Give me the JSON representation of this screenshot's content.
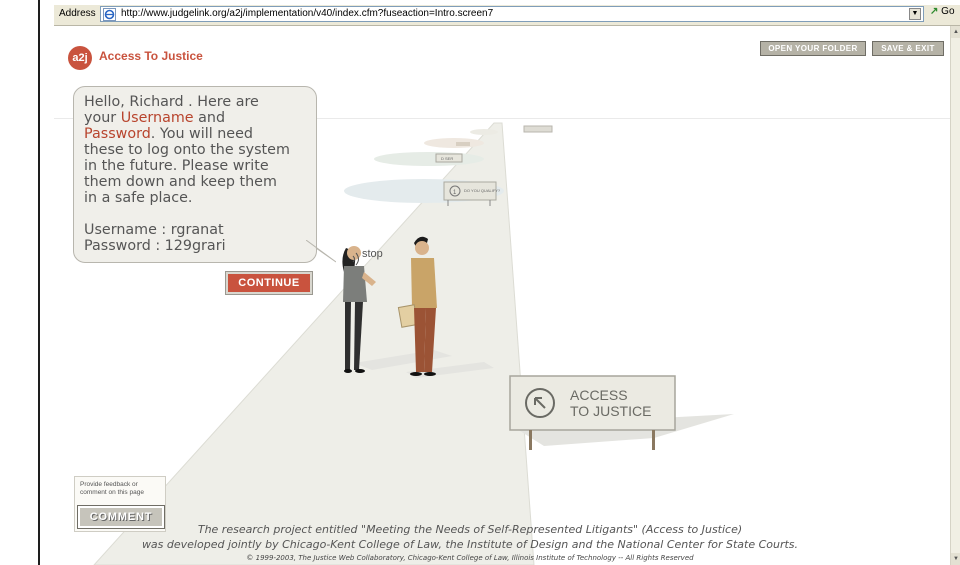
{
  "browser": {
    "address_label": "Address",
    "url": "http://www.judgelink.org/a2j/implementation/v40/index.cfm?fuseaction=Intro.screen7",
    "go_label": "Go"
  },
  "header": {
    "logo_text": "a2j",
    "app_title": "Access To Justice",
    "open_folder_label": "OPEN YOUR FOLDER",
    "save_exit_label": "SAVE & EXIT"
  },
  "dialog": {
    "line_1": "Hello, Richard . Here are",
    "line_2a": "your ",
    "username_word": "Username",
    "line_2b": " and",
    "password_word": "Password",
    "line_3b": ". You will need",
    "line_4": "these to log onto the system",
    "line_5": "in the future. Please write",
    "line_6": "them down and keep them",
    "line_7": "in a safe place.",
    "username_line": "Username : rgranat",
    "password_line": "Password : 129grari"
  },
  "continue_label": "CONTINUE",
  "stop_label": "stop",
  "signs": {
    "sign_small": "DO YOU QUALIFY?",
    "sign_far": "D SER",
    "main_sign_line1": "ACCESS",
    "main_sign_line2": "TO JUSTICE"
  },
  "feedback": {
    "note": "Provide feedback or comment on this page",
    "comment_label": "COMMENT"
  },
  "footer": {
    "line1": "The research project entitled \"Meeting the Needs of Self-Represented Litigants\" (Access to Justice)",
    "line2": "was developed jointly by Chicago-Kent College of Law, the Institute of Design and the National Center for State Courts.",
    "copyright": "© 1999-2003, The Justice Web Collaboratory, Chicago-Kent College of Law, Illinois Institute of Technology -- All Rights Reserved"
  },
  "colors": {
    "accent": "#c9533e",
    "bubble_bg": "#f0efea",
    "path": "#eeeee8"
  }
}
